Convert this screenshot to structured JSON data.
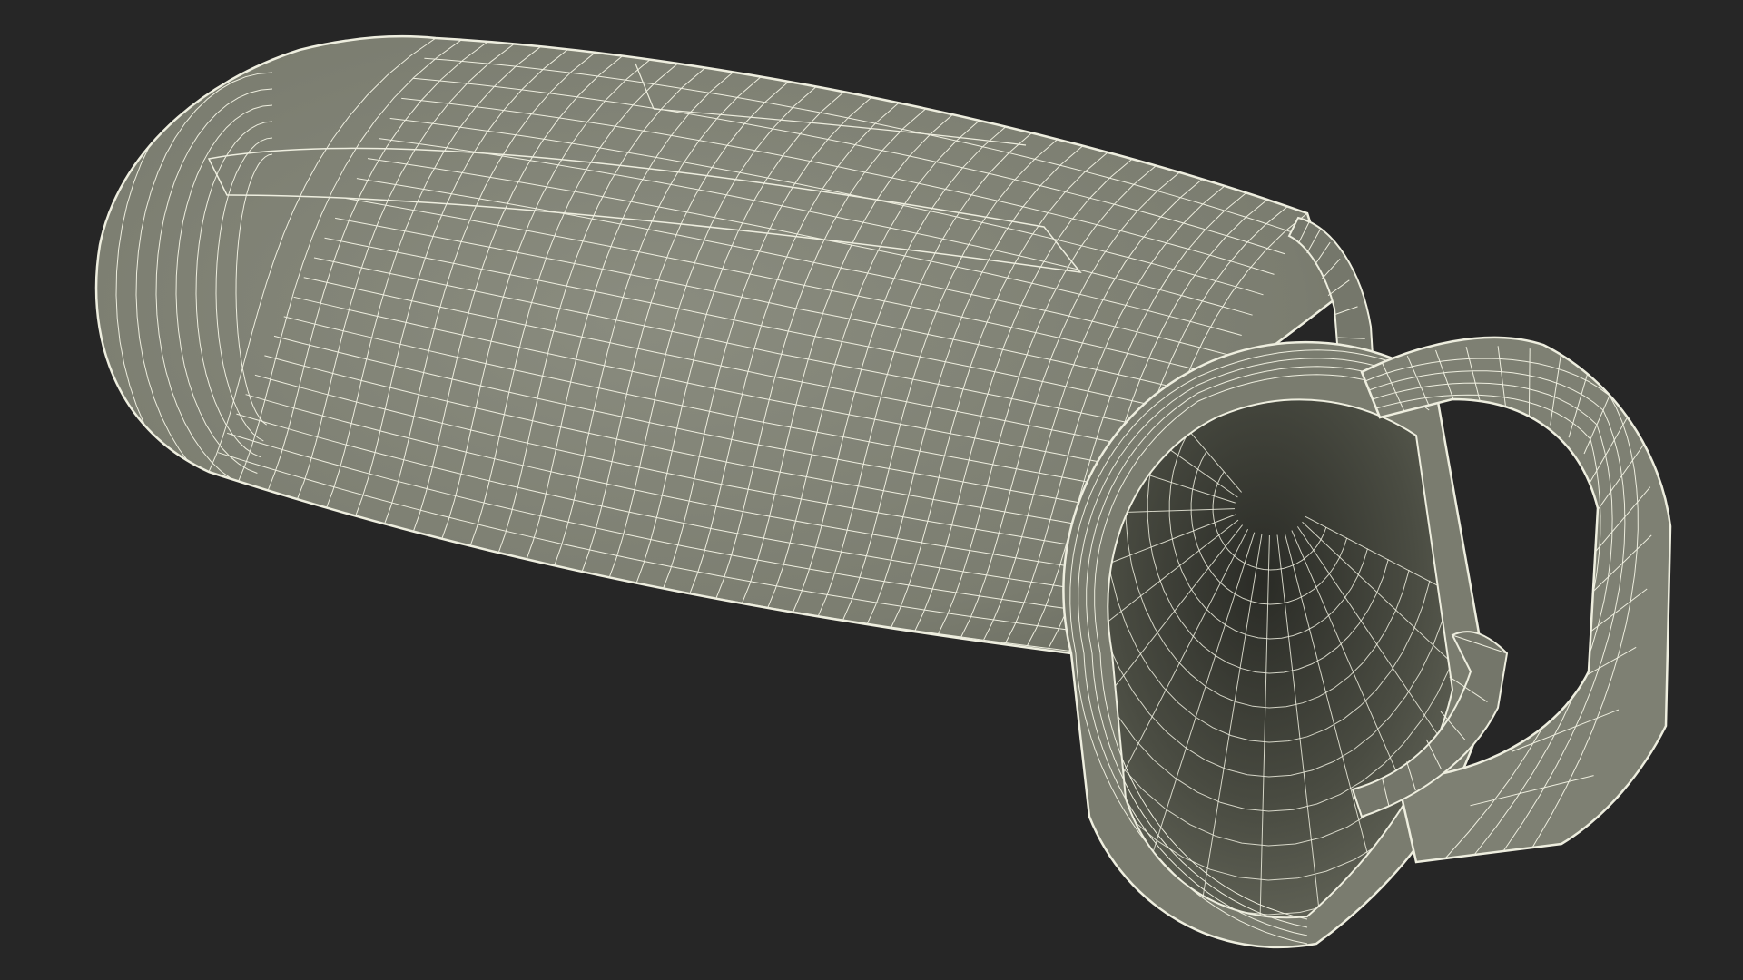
{
  "scene": {
    "background": "#262626",
    "mesh_fill": "#7d7f72",
    "mesh_fill_shadow": "#5f6155",
    "inner_fill": "#55574c",
    "inner_deep": "#2b2c27",
    "wire_color": "#eeeedf",
    "object": "wireframe-mesh-tube-with-strap"
  }
}
